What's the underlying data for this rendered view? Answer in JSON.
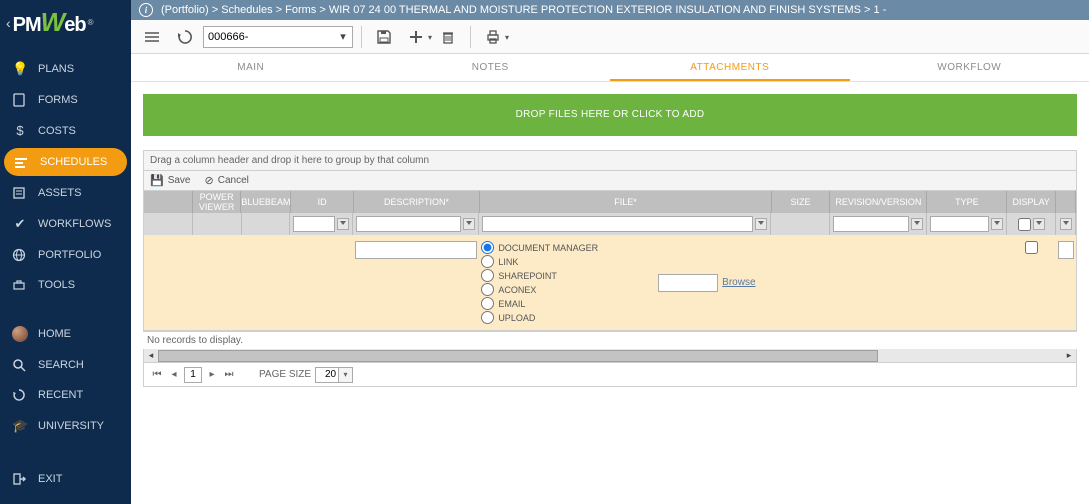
{
  "breadcrumb": "(Portfolio) > Schedules > Forms > WIR 07 24 00 THERMAL AND MOISTURE PROTECTION EXTERIOR INSULATION AND FINISH SYSTEMS > 1 -",
  "sidebar": {
    "items": [
      {
        "icon": "lightbulb",
        "label": "PLANS"
      },
      {
        "icon": "form",
        "label": "FORMS"
      },
      {
        "icon": "dollar",
        "label": "COSTS"
      },
      {
        "icon": "schedule",
        "label": "SCHEDULES",
        "active": true
      },
      {
        "icon": "asset",
        "label": "ASSETS"
      },
      {
        "icon": "check",
        "label": "WORKFLOWS"
      },
      {
        "icon": "globe",
        "label": "PORTFOLIO"
      },
      {
        "icon": "toolbox",
        "label": "TOOLS"
      }
    ],
    "lower": [
      {
        "icon": "avatar",
        "label": "HOME"
      },
      {
        "icon": "search",
        "label": "SEARCH"
      },
      {
        "icon": "recent",
        "label": "RECENT"
      },
      {
        "icon": "grad",
        "label": "UNIVERSITY"
      }
    ],
    "exit": {
      "label": "EXIT"
    }
  },
  "toolbar": {
    "record_value": "000666-"
  },
  "tabs": [
    {
      "label": "MAIN"
    },
    {
      "label": "NOTES"
    },
    {
      "label": "ATTACHMENTS",
      "active": true
    },
    {
      "label": "WORKFLOW"
    }
  ],
  "dropzone": {
    "text": "DROP FILES HERE OR CLICK TO ADD"
  },
  "groupbar": {
    "text": "Drag a column header and drop it here to group by that column"
  },
  "actions": {
    "save": "Save",
    "cancel": "Cancel"
  },
  "columns": {
    "power": "POWER VIEWER",
    "blue": "BLUEBEAM",
    "id": "ID",
    "desc": "DESCRIPTION*",
    "file": "FILE*",
    "size": "SIZE",
    "rev": "REVISION/VERSION",
    "type": "TYPE",
    "disp": "DISPLAY"
  },
  "file_source": {
    "options": [
      "DOCUMENT MANAGER",
      "LINK",
      "SHAREPOINT",
      "ACONEX",
      "EMAIL",
      "UPLOAD"
    ],
    "selected": "DOCUMENT MANAGER",
    "browse": "Browse"
  },
  "grid": {
    "no_records": "No records to display."
  },
  "pager": {
    "page": "1",
    "pagesize_label": "PAGE SIZE",
    "pagesize_value": "20"
  }
}
